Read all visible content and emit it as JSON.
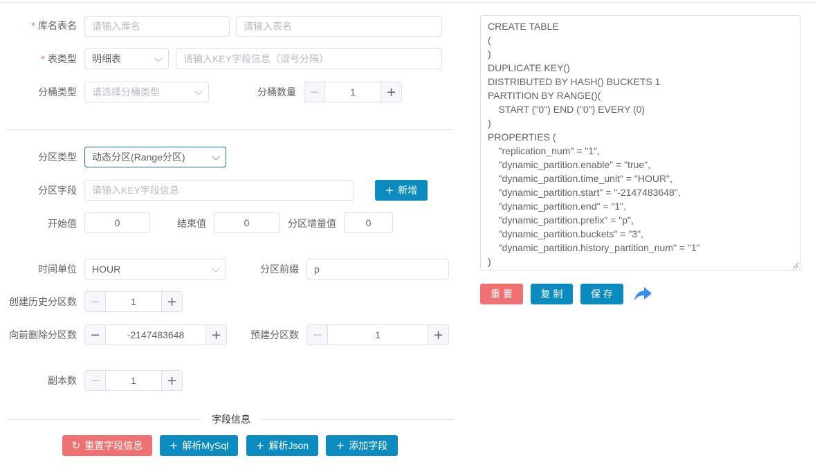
{
  "form": {
    "db_table": {
      "label": "库名表名",
      "db_placeholder": "请输入库名",
      "table_placeholder": "请输入表名"
    },
    "table_type": {
      "label": "表类型",
      "value": "明细表",
      "key_placeholder": "请输入KEY字段信息（逗号分隔）"
    },
    "bucket": {
      "type_label": "分桶类型",
      "type_placeholder": "请选择分桶类型",
      "count_label": "分桶数量",
      "count_value": "1"
    },
    "partition": {
      "type_label": "分区类型",
      "type_value": "动态分区(Range分区)",
      "field_label": "分区字段",
      "field_placeholder": "请输入KEY字段信息",
      "add_label": "新增",
      "start_label": "开始值",
      "start_value": "0",
      "end_label": "结束值",
      "end_value": "0",
      "step_label": "分区增量值",
      "step_value": "0",
      "time_unit_label": "时间单位",
      "time_unit_value": "HOUR",
      "prefix_label": "分区前缀",
      "prefix_value": "p",
      "history_label": "创建历史分区数",
      "history_value": "1",
      "delete_label": "向前删除分区数",
      "delete_value": "-2147483648",
      "prebuild_label": "预建分区数",
      "prebuild_value": "1",
      "replica_label": "副本数",
      "replica_value": "1"
    },
    "fields": {
      "section_title": "字段信息",
      "reset_label": "重置字段信息",
      "parse_mysql_label": "解析MySql",
      "parse_json_label": "解析Json",
      "add_field_label": "添加字段"
    }
  },
  "sql": {
    "lines": [
      "CREATE TABLE",
      "(",
      ")",
      "DUPLICATE KEY()",
      "DISTRIBUTED BY HASH() BUCKETS 1",
      "PARTITION BY RANGE()(",
      "    START (\"0\") END (\"0\") EVERY (0)",
      ")",
      "PROPERTIES (",
      "    \"replication_num\" = \"1\",",
      "    \"dynamic_partition.enable\" = \"true\",",
      "    \"dynamic_partition.time_unit\" = \"HOUR\",",
      "    \"dynamic_partition.start\" = \"-2147483648\",",
      "    \"dynamic_partition.end\" = \"1\",",
      "    \"dynamic_partition.prefix\" = \"p\",",
      "    \"dynamic_partition.buckets\" = \"3\",",
      "    \"dynamic_partition.history_partition_num\" = \"1\"",
      ")"
    ]
  },
  "actions": {
    "reset_label": "重 置",
    "copy_label": "复 制",
    "save_label": "保 存"
  },
  "icons": {
    "plus": "plus-icon",
    "minus": "minus-icon",
    "refresh": "refresh-icon",
    "share": "share-arrow-icon",
    "chevron": "chevron-down-icon"
  },
  "colors": {
    "primary": "#0b8bbf",
    "danger": "#f07171",
    "required": "#f56c6c",
    "share_icon": "#3a8ee6"
  }
}
